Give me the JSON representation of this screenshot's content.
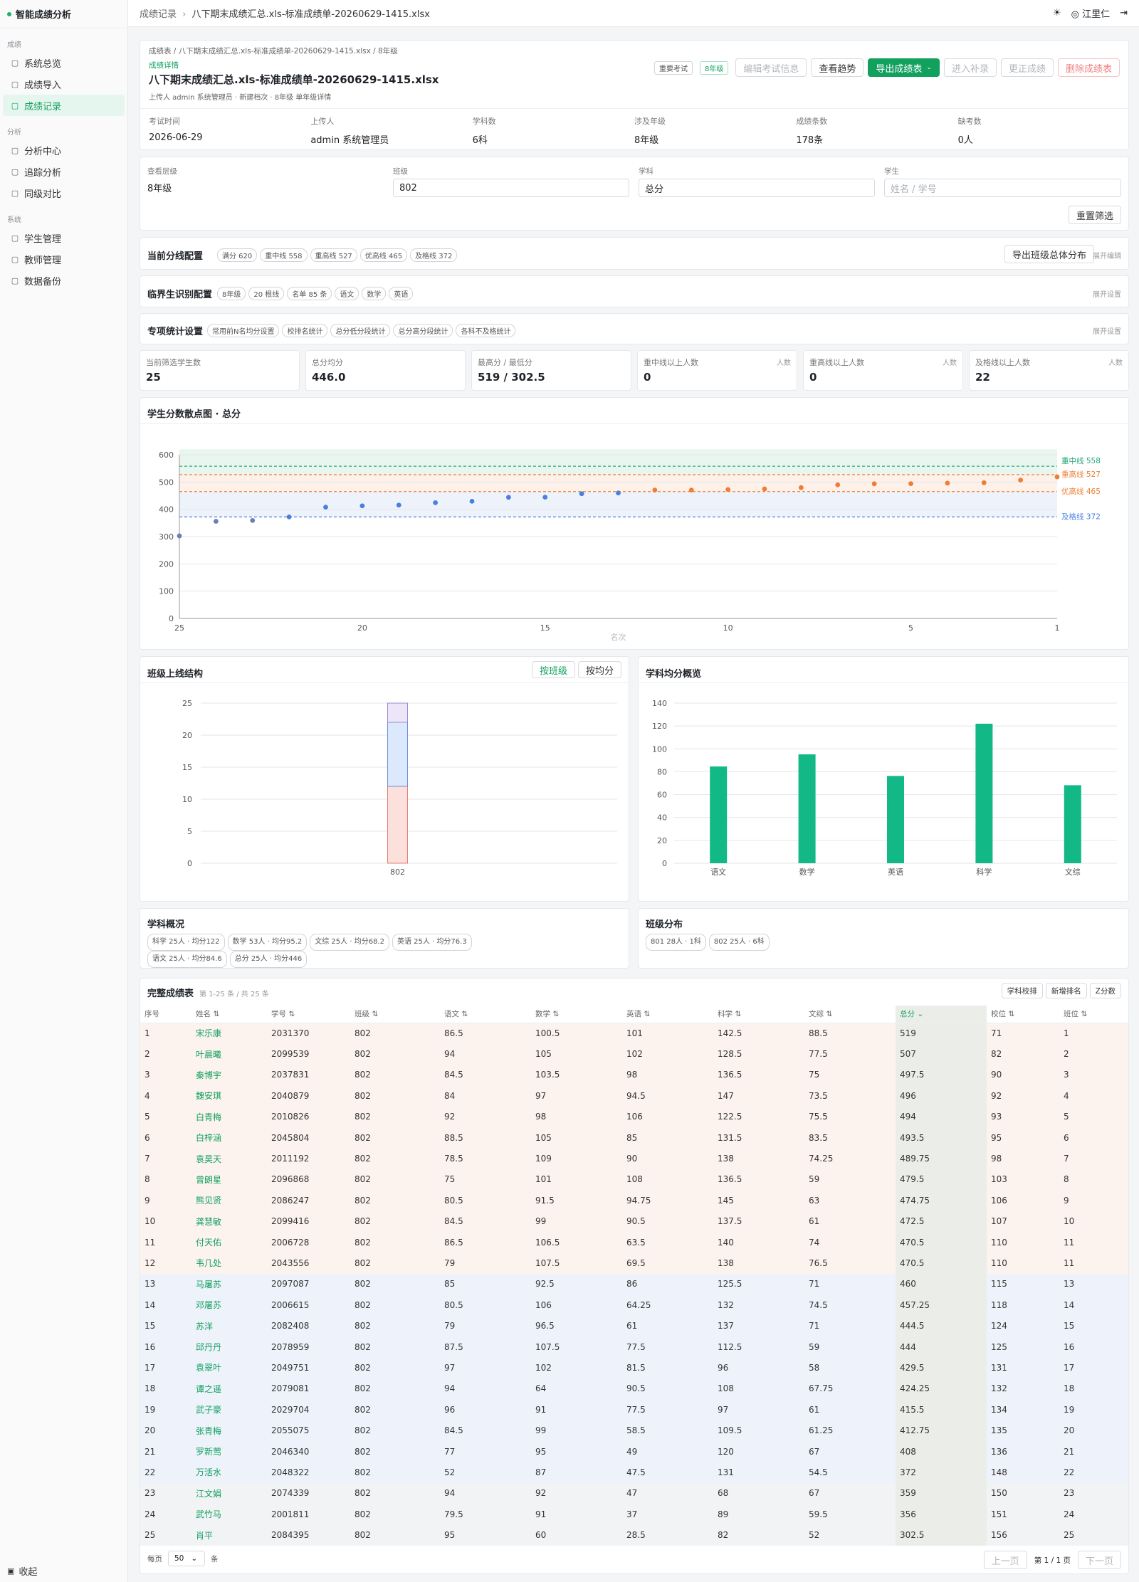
{
  "app": {
    "title": "智能成绩分析"
  },
  "sidebar": {
    "sections": [
      {
        "label": "成绩",
        "items": [
          {
            "label": "系统总览",
            "icon": "dashboard-icon"
          },
          {
            "label": "成绩导入",
            "icon": "upload-icon"
          },
          {
            "label": "成绩记录",
            "icon": "document-icon",
            "active": true
          }
        ]
      },
      {
        "label": "分析",
        "items": [
          {
            "label": "分析中心",
            "icon": "grid-icon"
          },
          {
            "label": "追踪分析",
            "icon": "track-icon"
          },
          {
            "label": "同级对比",
            "icon": "compare-icon"
          }
        ]
      },
      {
        "label": "系统",
        "items": [
          {
            "label": "学生管理",
            "icon": "users-icon"
          },
          {
            "label": "教师管理",
            "icon": "teacher-icon"
          },
          {
            "label": "数据备份",
            "icon": "database-icon"
          }
        ]
      }
    ],
    "collapse_label": "收起"
  },
  "topbar": {
    "crumb_root": "成绩记录",
    "crumb_sep": "›",
    "crumb_current": "八下期末成绩汇总.xls-标准成绩单-20260629-1415.xlsx",
    "user": "江里仁"
  },
  "header": {
    "crumb": "成绩表 / 八下期末成绩汇总.xls-标准成绩单-20260629-1415.xlsx / 8年级",
    "subtitle": "成绩详情",
    "title": "八下期末成绩汇总.xls-标准成绩单-20260629-1415.xlsx",
    "meta": "上传人 admin 系统管理员 · 新建档次 · 8年级 单年级详情",
    "tags": [
      "重要考试",
      "8年级"
    ],
    "buttons": {
      "edit": "编辑考试信息",
      "trend": "查看趋势",
      "export": "导出成绩表",
      "makeup": "进入补录",
      "correct": "更正成绩",
      "delete": "删除成绩表"
    },
    "info": [
      {
        "label": "考试时间",
        "value": "2026-06-29"
      },
      {
        "label": "上传人",
        "value": "admin 系统管理员"
      },
      {
        "label": "学科数",
        "value": "6科"
      },
      {
        "label": "涉及年级",
        "value": "8年级"
      },
      {
        "label": "成绩条数",
        "value": "178条"
      },
      {
        "label": "缺考数",
        "value": "0人"
      }
    ]
  },
  "filters": {
    "grade_label": "查看层级",
    "grade_value": "8年级",
    "class_label": "班级",
    "class_value": "802",
    "subject_label": "学科",
    "subject_value": "总分",
    "student_label": "学生",
    "student_placeholder": "姓名 / 学号",
    "reset": "重置筛选"
  },
  "scoreline": {
    "title": "当前分线配置",
    "tags": [
      "满分 620",
      "重中线 558",
      "重高线 527",
      "优高线 465",
      "及格线 372"
    ],
    "button": "导出班级总体分布",
    "link": "展开编辑"
  },
  "critical": {
    "title": "临界生识别配置",
    "tags": [
      "8年级",
      "20 根线",
      "名单 85 条",
      "语文",
      "数学",
      "英语"
    ],
    "link": "展开设置"
  },
  "special": {
    "title": "专项统计设置",
    "tags": [
      "常用前N名均分设置",
      "校排名统计",
      "总分低分段统计",
      "总分高分段统计",
      "各科不及格统计"
    ],
    "link": "展开设置"
  },
  "stats": [
    {
      "label": "当前筛选学生数",
      "value": "25",
      "unit": ""
    },
    {
      "label": "总分均分",
      "value": "446.0",
      "unit": ""
    },
    {
      "label": "最高分 / 最低分",
      "value": "519 / 302.5",
      "unit": ""
    },
    {
      "label": "重中线以上人数",
      "value": "0",
      "unit": "人数"
    },
    {
      "label": "重高线以上人数",
      "value": "0",
      "unit": "人数"
    },
    {
      "label": "及格线以上人数",
      "value": "22",
      "unit": "人数"
    }
  ],
  "scatter_title": "学生分数散点图 · 总分",
  "bar_title": "班级上线结构",
  "bar_toggle": [
    "按班级",
    "按均分"
  ],
  "subject_title": "学科均分概览",
  "overview": {
    "title": "学科概况",
    "tags": [
      "科学 25人 · 均分122",
      "数学 53人 · 均分95.2",
      "文综 25人 · 均分68.2",
      "英语 25人 · 均分76.3",
      "语文 25人 · 均分84.6",
      "总分 25人 · 均分446"
    ]
  },
  "classdist": {
    "title": "班级分布",
    "tags": [
      "801 28人 · 1科",
      "802 25人 · 6科"
    ]
  },
  "table": {
    "title": "完整成绩表",
    "subtitle": "第 1-25 条 / 共 25 条",
    "buttons": [
      "学科校排",
      "新增排名",
      "Z分数"
    ],
    "headers": [
      "序号",
      "姓名 ⇅",
      "学号 ⇅",
      "班级 ⇅",
      "语文 ⇅",
      "数学 ⇅",
      "英语 ⇅",
      "科学 ⇅",
      "文综 ⇅",
      "总分 ⌄",
      "校位 ⇅",
      "班位 ⇅"
    ]
  },
  "pagination": {
    "per_page_label": "每页",
    "per_page": "50",
    "unit": "条",
    "prev": "上一页",
    "page": "第 1 / 1 页",
    "next": "下一页"
  },
  "chart_data": [
    {
      "type": "scatter",
      "title": "学生分数散点图 · 总分",
      "xlabel": "名次",
      "ylim": [
        0,
        600
      ],
      "yticks": [
        0,
        100,
        200,
        300,
        400,
        500,
        600
      ],
      "xticks": [
        25,
        20,
        15,
        10,
        5,
        1
      ],
      "x_reversed": true,
      "series": [
        {
          "values": [
            [
              25,
              302.5
            ],
            [
              24,
              356
            ],
            [
              23,
              359
            ],
            [
              22,
              372
            ],
            [
              21,
              408
            ],
            [
              20,
              412.75
            ],
            [
              19,
              415.5
            ],
            [
              18,
              424.25
            ],
            [
              17,
              429.5
            ],
            [
              16,
              444
            ],
            [
              15,
              444.5
            ],
            [
              14,
              457.25
            ],
            [
              13,
              460
            ],
            [
              12,
              470.5
            ],
            [
              11,
              470.5
            ],
            [
              10,
              472.5
            ],
            [
              9,
              474.75
            ],
            [
              8,
              479.5
            ],
            [
              7,
              489.75
            ],
            [
              6,
              493.5
            ],
            [
              5,
              494
            ],
            [
              4,
              496
            ],
            [
              3,
              497.5
            ],
            [
              2,
              507
            ],
            [
              1,
              519
            ]
          ]
        }
      ],
      "lines": [
        {
          "name": "重中线 558",
          "value": 558,
          "color": "#2aa876"
        },
        {
          "name": "重高线 527",
          "value": 527,
          "color": "#ef7d33"
        },
        {
          "name": "优高线 465",
          "value": 465,
          "color": "#ef7d33"
        },
        {
          "name": "及格线 372",
          "value": 372,
          "color": "#4a7fe0"
        }
      ]
    },
    {
      "type": "bar",
      "title": "班级上线结构",
      "categories": [
        "802"
      ],
      "ylim": [
        0,
        25
      ],
      "yticks": [
        0,
        5,
        10,
        15,
        20,
        25
      ],
      "series": [
        {
          "values": [
            12
          ],
          "color": "#fbe0db"
        },
        {
          "values": [
            10
          ],
          "color": "#dce8fb"
        },
        {
          "values": [
            3
          ],
          "color": "#ece6f8"
        }
      ]
    },
    {
      "type": "bar",
      "title": "学科均分概览",
      "categories": [
        "语文",
        "数学",
        "英语",
        "科学",
        "文综"
      ],
      "values": [
        84.6,
        95.2,
        76.3,
        122,
        68.2
      ],
      "ylim": [
        0,
        140
      ],
      "yticks": [
        0,
        20,
        40,
        60,
        80,
        100,
        120,
        140
      ],
      "color": "#12b886"
    }
  ],
  "rows": [
    [
      "1",
      "宋乐康",
      "2031370",
      "802",
      "86.5",
      "100.5",
      "101",
      "142.5",
      "88.5",
      "519",
      "71",
      "1"
    ],
    [
      "2",
      "叶晨曦",
      "2099539",
      "802",
      "94",
      "105",
      "102",
      "128.5",
      "77.5",
      "507",
      "82",
      "2"
    ],
    [
      "3",
      "秦博宇",
      "2037831",
      "802",
      "84.5",
      "103.5",
      "98",
      "136.5",
      "75",
      "497.5",
      "90",
      "3"
    ],
    [
      "4",
      "魏安琪",
      "2040879",
      "802",
      "84",
      "97",
      "94.5",
      "147",
      "73.5",
      "496",
      "92",
      "4"
    ],
    [
      "5",
      "白青梅",
      "2010826",
      "802",
      "92",
      "98",
      "106",
      "122.5",
      "75.5",
      "494",
      "93",
      "5"
    ],
    [
      "6",
      "白梓涵",
      "2045804",
      "802",
      "88.5",
      "105",
      "85",
      "131.5",
      "83.5",
      "493.5",
      "95",
      "6"
    ],
    [
      "7",
      "袁昊天",
      "2011192",
      "802",
      "78.5",
      "109",
      "90",
      "138",
      "74.25",
      "489.75",
      "98",
      "7"
    ],
    [
      "8",
      "曾朗星",
      "2096868",
      "802",
      "75",
      "101",
      "108",
      "136.5",
      "59",
      "479.5",
      "103",
      "8"
    ],
    [
      "9",
      "熊见贤",
      "2086247",
      "802",
      "80.5",
      "91.5",
      "94.75",
      "145",
      "63",
      "474.75",
      "106",
      "9"
    ],
    [
      "10",
      "龚慧敏",
      "2099416",
      "802",
      "84.5",
      "99",
      "90.5",
      "137.5",
      "61",
      "472.5",
      "107",
      "10"
    ],
    [
      "11",
      "付天佑",
      "2006728",
      "802",
      "86.5",
      "106.5",
      "63.5",
      "140",
      "74",
      "470.5",
      "110",
      "11"
    ],
    [
      "12",
      "韦几处",
      "2043556",
      "802",
      "79",
      "107.5",
      "69.5",
      "138",
      "76.5",
      "470.5",
      "110",
      "11"
    ],
    [
      "13",
      "马屠苏",
      "2097087",
      "802",
      "85",
      "92.5",
      "86",
      "125.5",
      "71",
      "460",
      "115",
      "13"
    ],
    [
      "14",
      "邓屠苏",
      "2006615",
      "802",
      "80.5",
      "106",
      "64.25",
      "132",
      "74.5",
      "457.25",
      "118",
      "14"
    ],
    [
      "15",
      "苏洋",
      "2082408",
      "802",
      "79",
      "96.5",
      "61",
      "137",
      "71",
      "444.5",
      "124",
      "15"
    ],
    [
      "16",
      "邱丹丹",
      "2078959",
      "802",
      "87.5",
      "107.5",
      "77.5",
      "112.5",
      "59",
      "444",
      "125",
      "16"
    ],
    [
      "17",
      "袁翠叶",
      "2049751",
      "802",
      "97",
      "102",
      "81.5",
      "96",
      "58",
      "429.5",
      "131",
      "17"
    ],
    [
      "18",
      "谭之遥",
      "2079081",
      "802",
      "94",
      "64",
      "90.5",
      "108",
      "67.75",
      "424.25",
      "132",
      "18"
    ],
    [
      "19",
      "武子豪",
      "2029704",
      "802",
      "96",
      "91",
      "77.5",
      "97",
      "61",
      "415.5",
      "134",
      "19"
    ],
    [
      "20",
      "张青梅",
      "2055075",
      "802",
      "84.5",
      "99",
      "58.5",
      "109.5",
      "61.25",
      "412.75",
      "135",
      "20"
    ],
    [
      "21",
      "罗新莺",
      "2046340",
      "802",
      "77",
      "95",
      "49",
      "120",
      "67",
      "408",
      "136",
      "21"
    ],
    [
      "22",
      "万活水",
      "2048322",
      "802",
      "52",
      "87",
      "47.5",
      "131",
      "54.5",
      "372",
      "148",
      "22"
    ],
    [
      "23",
      "江文娟",
      "2074339",
      "802",
      "94",
      "92",
      "47",
      "68",
      "67",
      "359",
      "150",
      "23"
    ],
    [
      "24",
      "武竹马",
      "2001811",
      "802",
      "79.5",
      "91",
      "37",
      "89",
      "59.5",
      "356",
      "151",
      "24"
    ],
    [
      "25",
      "肖平",
      "2084395",
      "802",
      "95",
      "60",
      "28.5",
      "82",
      "52",
      "302.5",
      "156",
      "25"
    ]
  ]
}
